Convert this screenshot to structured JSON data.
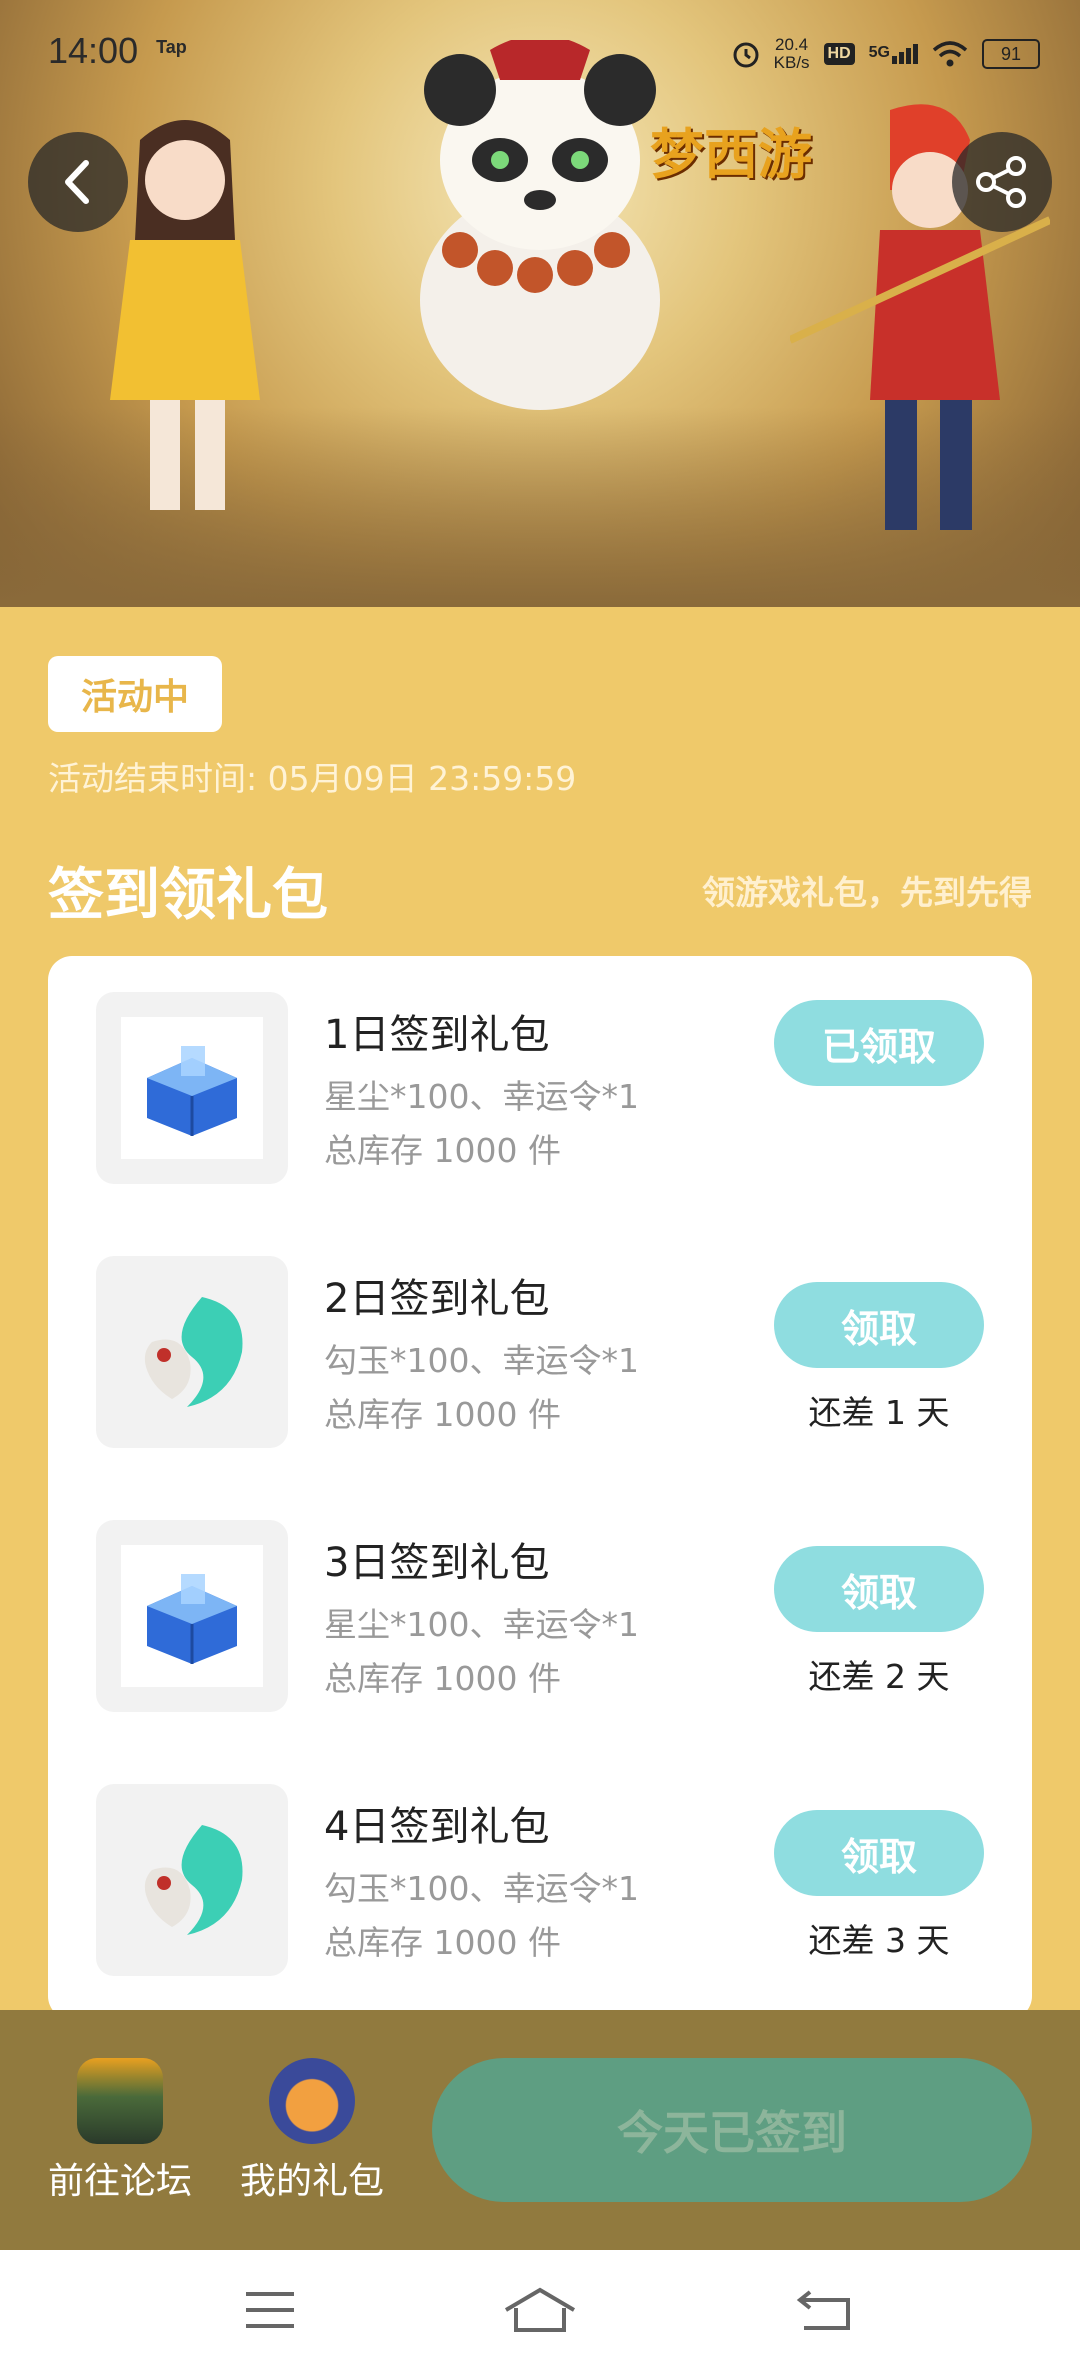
{
  "status_bar": {
    "time": "14:00",
    "tap_label": "Tap",
    "net_speed": "20.4",
    "net_unit": "KB/s",
    "hd": "HD",
    "signal": "5G",
    "battery": "91"
  },
  "hero": {
    "game_logo": "梦西游"
  },
  "activity": {
    "status_tag": "活动中",
    "end_time_label": "活动结束时间: 05月09日 23:59:59"
  },
  "section": {
    "title": "签到领礼包",
    "subtitle": "领游戏礼包，先到先得"
  },
  "gifts": [
    {
      "title": "1日签到礼包",
      "desc": "星尘*100、幸运令*1",
      "stock": "总库存 1000 件",
      "button": "已领取",
      "remain": "",
      "icon": "blue-chest-icon"
    },
    {
      "title": "2日签到礼包",
      "desc": "勾玉*100、幸运令*1",
      "stock": "总库存 1000 件",
      "button": "领取",
      "remain": "还差 1 天",
      "icon": "jade-magatama-icon"
    },
    {
      "title": "3日签到礼包",
      "desc": "星尘*100、幸运令*1",
      "stock": "总库存 1000 件",
      "button": "领取",
      "remain": "还差 2 天",
      "icon": "blue-chest-icon"
    },
    {
      "title": "4日签到礼包",
      "desc": "勾玉*100、幸运令*1",
      "stock": "总库存 1000 件",
      "button": "领取",
      "remain": "还差 3 天",
      "icon": "jade-magatama-icon"
    }
  ],
  "bottom": {
    "forum_label": "前往论坛",
    "mygifts_label": "我的礼包",
    "sign_button": "今天已签到"
  },
  "colors": {
    "page_bg": "#EFC96A",
    "claim_button": "#8FDDE0",
    "bottom_bar": "#917A3E",
    "sign_button": "#5E9E82"
  }
}
